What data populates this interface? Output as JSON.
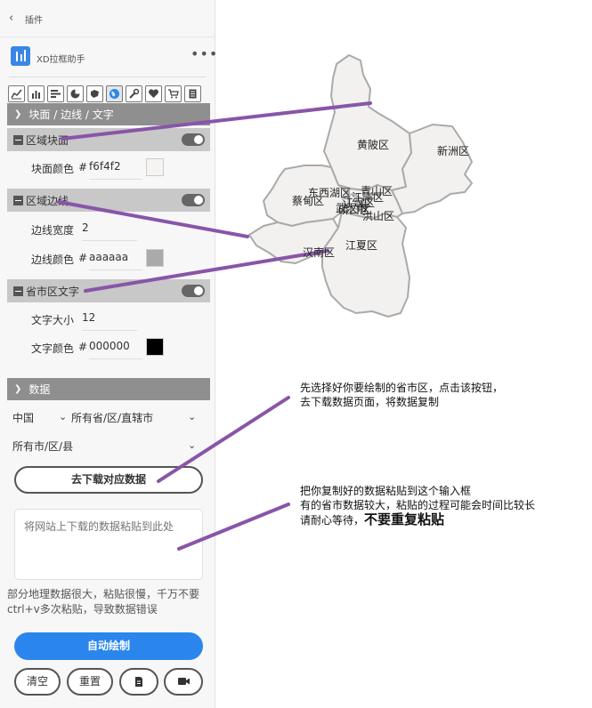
{
  "topbar": {
    "back_icon": "back-arrow-icon",
    "title": "插件"
  },
  "plugin": {
    "name": "XD拉框助手",
    "more_icon": "more-dots-icon",
    "logo_icon": "plugin-logo-icon"
  },
  "iconbar": {
    "icons": [
      "line-chart-icon",
      "bar-chart-icon",
      "horizontal-bar-icon",
      "pie-chart-icon",
      "map-icon",
      "globe-icon",
      "wrench-icon",
      "heart-icon",
      "cart-icon",
      "document-icon"
    ],
    "active": "globe-icon"
  },
  "sections": {
    "layers_title": "块面 / 边线 / 文字",
    "data_title": "数据"
  },
  "layers": {
    "fill": {
      "label": "区域块面",
      "enabled": true,
      "color_label": "块面颜色",
      "color_hash": "#",
      "color_value": "f6f4f2"
    },
    "border": {
      "label": "区域边线",
      "enabled": true,
      "width_label": "边线宽度",
      "width_value": "2",
      "color_label": "边线颜色",
      "color_hash": "#",
      "color_value": "aaaaaa"
    },
    "text": {
      "label": "省市区文字",
      "enabled": true,
      "size_label": "文字大小",
      "size_value": "12",
      "color_label": "文字颜色",
      "color_hash": "#",
      "color_value": "000000"
    }
  },
  "data_panel": {
    "country": "中国",
    "province": "所有省/区/直辖市",
    "city": "所有市/区/县",
    "download_button": "去下载对应数据",
    "paste_placeholder": "将网站上下载的数据粘贴到此处",
    "warning": "部分地理数据很大，粘贴很慢，千万不要ctrl+v多次粘贴，导致数据错误",
    "draw_button": "自动绘制",
    "clear_button": "清空",
    "reset_button": "重置",
    "doc_icon": "document-icon",
    "video_icon": "video-icon"
  },
  "map": {
    "fill_color": "#f2f1f0",
    "stroke_color": "#aaaaaa",
    "labels": [
      "黄陂区",
      "新洲区",
      "东西湖区",
      "蔡甸区",
      "江岸区",
      "武汉市",
      "青山区",
      "洪山区",
      "汉南区",
      "江夏区",
      "江汉区",
      "硚口区"
    ]
  },
  "annotations": {
    "color": "#8855a8",
    "note1_line1": "先选择好你要绘制的省市区，点击该按钮，",
    "note1_line2": "去下载数据页面，将数据复制",
    "note2_line1": "把你复制好的数据粘贴到这个输入框",
    "note2_line2": "有的省市数据较大，粘贴的过程可能会时间比较长",
    "note2_line3a": "请耐心等待，",
    "note2_line3b": "不要重复粘贴"
  }
}
